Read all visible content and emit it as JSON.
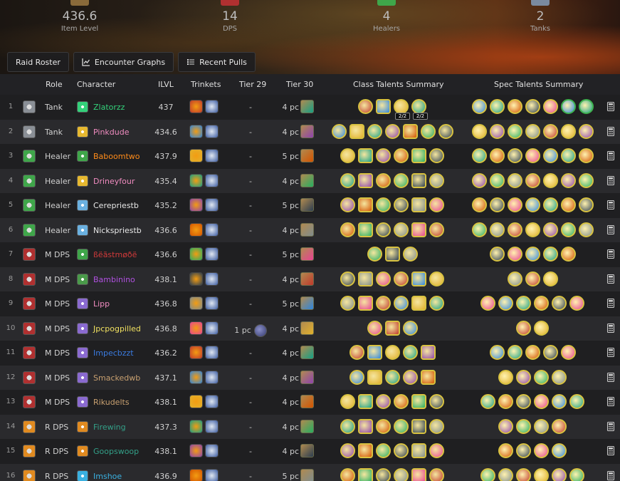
{
  "stats": [
    {
      "value": "436.6",
      "label": "Item Level",
      "color": "#8a6a3a"
    },
    {
      "value": "14",
      "label": "DPS",
      "color": "#b03030"
    },
    {
      "value": "4",
      "label": "Healers",
      "color": "#3fa64a"
    },
    {
      "value": "2",
      "label": "Tanks",
      "color": "#7a8aa0"
    }
  ],
  "tabs": [
    {
      "label": "Raid Roster",
      "icon": ""
    },
    {
      "label": "Encounter Graphs",
      "icon": "chart-icon"
    },
    {
      "label": "Recent Pulls",
      "icon": "list-icon"
    }
  ],
  "table": {
    "headers": {
      "role": "Role",
      "character": "Character",
      "ilvl": "ILVL",
      "trinkets": "Trinkets",
      "tier29": "Tier 29",
      "tier30": "Tier 30",
      "class_talents": "Class Talents Summary",
      "spec_talents": "Spec Talents Summary"
    },
    "rows": [
      {
        "idx": "1",
        "role": "Tank",
        "name": "Zlatorzz",
        "name_color": "#33d17a",
        "ilvl": "437",
        "tier29": "-",
        "tier30": "4 pc",
        "role_color": "#8a8f96",
        "spec_color": "#33d17a",
        "class_n": 4,
        "spec_n": 7,
        "badges": [
          "",
          "",
          "2/2",
          "2/2"
        ]
      },
      {
        "idx": "2",
        "role": "Tank",
        "name": "Pinkdude",
        "name_color": "#f08cc0",
        "ilvl": "434.6",
        "tier29": "-",
        "tier30": "4 pc",
        "role_color": "#8a8f96",
        "spec_color": "#e6b830",
        "class_n": 7,
        "spec_n": 7
      },
      {
        "idx": "3",
        "role": "Healer",
        "name": "Baboomtwo",
        "name_color": "#ff8c1a",
        "ilvl": "437.9",
        "tier29": "-",
        "tier30": "5 pc",
        "role_color": "#3fa64a",
        "spec_color": "#3fa64a",
        "class_n": 6,
        "spec_n": 7
      },
      {
        "idx": "4",
        "role": "Healer",
        "name": "Drineyfour",
        "name_color": "#f08cc0",
        "ilvl": "435.4",
        "tier29": "-",
        "tier30": "4 pc",
        "role_color": "#3fa64a",
        "spec_color": "#e6b830",
        "class_n": 6,
        "spec_n": 7
      },
      {
        "idx": "5",
        "role": "Healer",
        "name": "Cerepriestb",
        "name_color": "#e8e8e8",
        "ilvl": "435.2",
        "tier29": "-",
        "tier30": "5 pc",
        "role_color": "#3fa64a",
        "spec_color": "#6ab0e0",
        "class_n": 6,
        "spec_n": 7
      },
      {
        "idx": "6",
        "role": "Healer",
        "name": "Nickspriestb",
        "name_color": "#e8e8e8",
        "ilvl": "436.6",
        "tier29": "-",
        "tier30": "4 pc",
        "role_color": "#3fa64a",
        "spec_color": "#6ab0e0",
        "class_n": 6,
        "spec_n": 7
      },
      {
        "idx": "7",
        "role": "M DPS",
        "name": "ßëãstmøðë",
        "name_color": "#d23a3a",
        "ilvl": "436.6",
        "tier29": "-",
        "tier30": "5 pc",
        "role_color": "#b03030",
        "spec_color": "#3fa64a",
        "class_n": 3,
        "spec_n": 5
      },
      {
        "idx": "8",
        "role": "M DPS",
        "name": "Bambinino",
        "name_color": "#b050e0",
        "ilvl": "438.1",
        "tier29": "-",
        "tier30": "4 pc",
        "role_color": "#b03030",
        "spec_color": "#4a9a4a",
        "class_n": 6,
        "spec_n": 3
      },
      {
        "idx": "9",
        "role": "M DPS",
        "name": "Lipp",
        "name_color": "#f08cc0",
        "ilvl": "436.8",
        "tier29": "-",
        "tier30": "5 pc",
        "role_color": "#b03030",
        "spec_color": "#8a6ad0",
        "class_n": 6,
        "spec_n": 6
      },
      {
        "idx": "10",
        "role": "M DPS",
        "name": "Jpcpogpilled",
        "name_color": "#f0e060",
        "ilvl": "436.8",
        "tier29": "1 pc",
        "tier30": "4 pc",
        "role_color": "#b03030",
        "spec_color": "#8a6ad0",
        "class_n": 3,
        "spec_n": 2
      },
      {
        "idx": "11",
        "role": "M DPS",
        "name": "Impecbzzt",
        "name_color": "#3a7be0",
        "ilvl": "436.2",
        "tier29": "-",
        "tier30": "4 pc",
        "role_color": "#b03030",
        "spec_color": "#8a6ad0",
        "class_n": 5,
        "spec_n": 5
      },
      {
        "idx": "12",
        "role": "M DPS",
        "name": "Smackedwb",
        "name_color": "#c8a070",
        "ilvl": "437.1",
        "tier29": "-",
        "tier30": "4 pc",
        "role_color": "#b03030",
        "spec_color": "#8a6ad0",
        "class_n": 5,
        "spec_n": 4
      },
      {
        "idx": "13",
        "role": "M DPS",
        "name": "Rikudelts",
        "name_color": "#c8a070",
        "ilvl": "438.1",
        "tier29": "-",
        "tier30": "4 pc",
        "role_color": "#b03030",
        "spec_color": "#8a6ad0",
        "class_n": 6,
        "spec_n": 6
      },
      {
        "idx": "14",
        "role": "R DPS",
        "name": "Firewing",
        "name_color": "#33a088",
        "ilvl": "437.3",
        "tier29": "-",
        "tier30": "4 pc",
        "role_color": "#e08a20",
        "spec_color": "#e08a20",
        "class_n": 6,
        "spec_n": 4
      },
      {
        "idx": "15",
        "role": "R DPS",
        "name": "Goopswoop",
        "name_color": "#33a088",
        "ilvl": "438.1",
        "tier29": "-",
        "tier30": "4 pc",
        "role_color": "#e08a20",
        "spec_color": "#e08a20",
        "class_n": 6,
        "spec_n": 4
      },
      {
        "idx": "16",
        "role": "R DPS",
        "name": "Imshoe",
        "name_color": "#3ab0e0",
        "ilvl": "436.9",
        "tier29": "-",
        "tier30": "5 pc",
        "role_color": "#e08a20",
        "spec_color": "#3ab0e0",
        "class_n": 6,
        "spec_n": 6
      }
    ]
  }
}
